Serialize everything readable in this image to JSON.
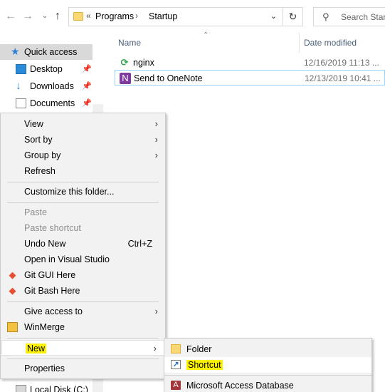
{
  "address_bar": {
    "back_icon": "arrow-left-icon",
    "forward_icon": "arrow-right-icon",
    "up_icon": "arrow-up-icon",
    "overflow_glyph": "«",
    "crumbs": [
      "Programs",
      "Startup"
    ],
    "separator": "›",
    "refresh_icon": "refresh-icon"
  },
  "search": {
    "placeholder": "Search Startup"
  },
  "nav_pane": {
    "quick_access": "Quick access",
    "items": [
      {
        "label": "Desktop",
        "icon": "desktop-icon"
      },
      {
        "label": "Downloads",
        "icon": "downloads-icon"
      },
      {
        "label": "Documents",
        "icon": "documents-icon"
      }
    ],
    "local_disk": "Local Disk (C:)"
  },
  "file_list": {
    "columns": {
      "name": "Name",
      "date": "Date modified"
    },
    "files": [
      {
        "name": "nginx",
        "date": "12/16/2019 11:13 ...",
        "icon": "nginx-icon"
      },
      {
        "name": "Send to OneNote",
        "date": "12/13/2019 10:41 ...",
        "icon": "onenote-icon"
      }
    ]
  },
  "context_menu": {
    "view": "View",
    "sort_by": "Sort by",
    "group_by": "Group by",
    "refresh": "Refresh",
    "customize": "Customize this folder...",
    "paste": "Paste",
    "paste_shortcut": "Paste shortcut",
    "undo_new": "Undo New",
    "undo_shortcut": "Ctrl+Z",
    "open_vs": "Open in Visual Studio",
    "git_gui": "Git GUI Here",
    "git_bash": "Git Bash Here",
    "give_access": "Give access to",
    "winmerge": "WinMerge",
    "new": "New",
    "properties": "Properties",
    "highlight_color": "#fff200"
  },
  "new_submenu": {
    "folder": "Folder",
    "shortcut": "Shortcut",
    "access_db": "Microsoft Access Database"
  }
}
